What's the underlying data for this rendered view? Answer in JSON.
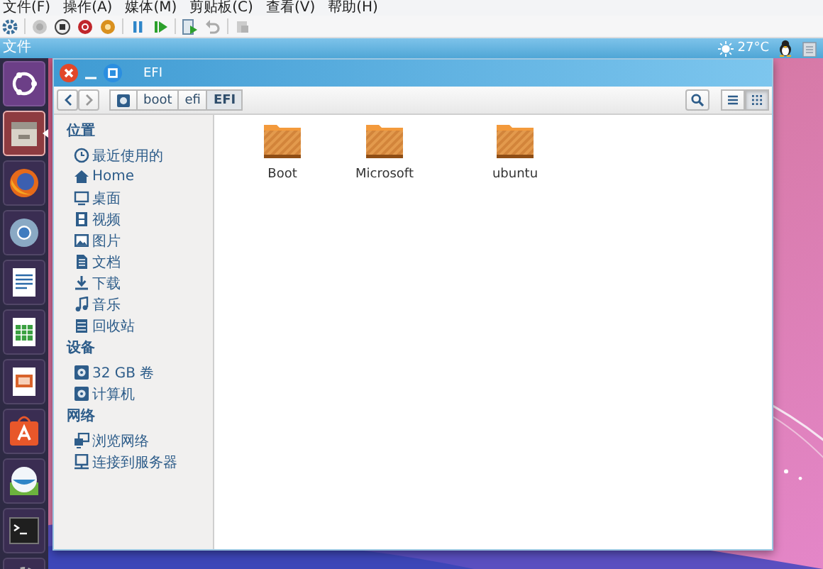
{
  "vm_menu": [
    "文件(F)",
    "操作(A)",
    "媒体(M)",
    "剪贴板(C)",
    "查看(V)",
    "帮助(H)"
  ],
  "vm_toolbar": [
    {
      "kind": "gear"
    },
    {
      "kind": "sep"
    },
    {
      "kind": "circle-grey"
    },
    {
      "kind": "stop"
    },
    {
      "kind": "record"
    },
    {
      "kind": "circle-orange"
    },
    {
      "kind": "sep"
    },
    {
      "kind": "pause"
    },
    {
      "kind": "play"
    },
    {
      "kind": "sep"
    },
    {
      "kind": "start-doc"
    },
    {
      "kind": "undo"
    },
    {
      "kind": "sep"
    },
    {
      "kind": "snapshot"
    }
  ],
  "top_panel": {
    "title": "文件",
    "weather": "27°C"
  },
  "launcher": [
    {
      "kind": "dash",
      "active": false
    },
    {
      "kind": "files",
      "active": true
    },
    {
      "kind": "firefox",
      "active": false
    },
    {
      "kind": "chromium",
      "active": false
    },
    {
      "kind": "writer",
      "active": false
    },
    {
      "kind": "calc",
      "active": false
    },
    {
      "kind": "impress",
      "active": false
    },
    {
      "kind": "software",
      "active": false
    },
    {
      "kind": "app",
      "active": false
    },
    {
      "kind": "terminal",
      "active": false
    },
    {
      "kind": "settings",
      "active": false
    }
  ],
  "window": {
    "title": "EFI",
    "path": [
      {
        "label": "boot",
        "selected": false
      },
      {
        "label": "efi",
        "selected": false
      },
      {
        "label": "EFI",
        "selected": true
      }
    ],
    "view_buttons": [
      {
        "kind": "list",
        "selected": false
      },
      {
        "kind": "grid",
        "selected": true
      }
    ],
    "sidebar": [
      {
        "heading": "位置",
        "items": [
          {
            "kind": "recent",
            "label": "最近使用的"
          },
          {
            "kind": "home",
            "label": "Home"
          },
          {
            "kind": "desktop",
            "label": "桌面"
          },
          {
            "kind": "video",
            "label": "视频"
          },
          {
            "kind": "picture",
            "label": "图片"
          },
          {
            "kind": "document",
            "label": "文档"
          },
          {
            "kind": "download",
            "label": "下载"
          },
          {
            "kind": "music",
            "label": "音乐"
          },
          {
            "kind": "trash",
            "label": "回收站"
          }
        ]
      },
      {
        "heading": "设备",
        "items": [
          {
            "kind": "drive",
            "label": "32 GB 卷"
          },
          {
            "kind": "drive",
            "label": "计算机"
          }
        ]
      },
      {
        "heading": "网络",
        "items": [
          {
            "kind": "network",
            "label": "浏览网络"
          },
          {
            "kind": "server",
            "label": "连接到服务器"
          }
        ]
      }
    ],
    "files": [
      "Boot",
      "Microsoft",
      "ubuntu"
    ]
  }
}
